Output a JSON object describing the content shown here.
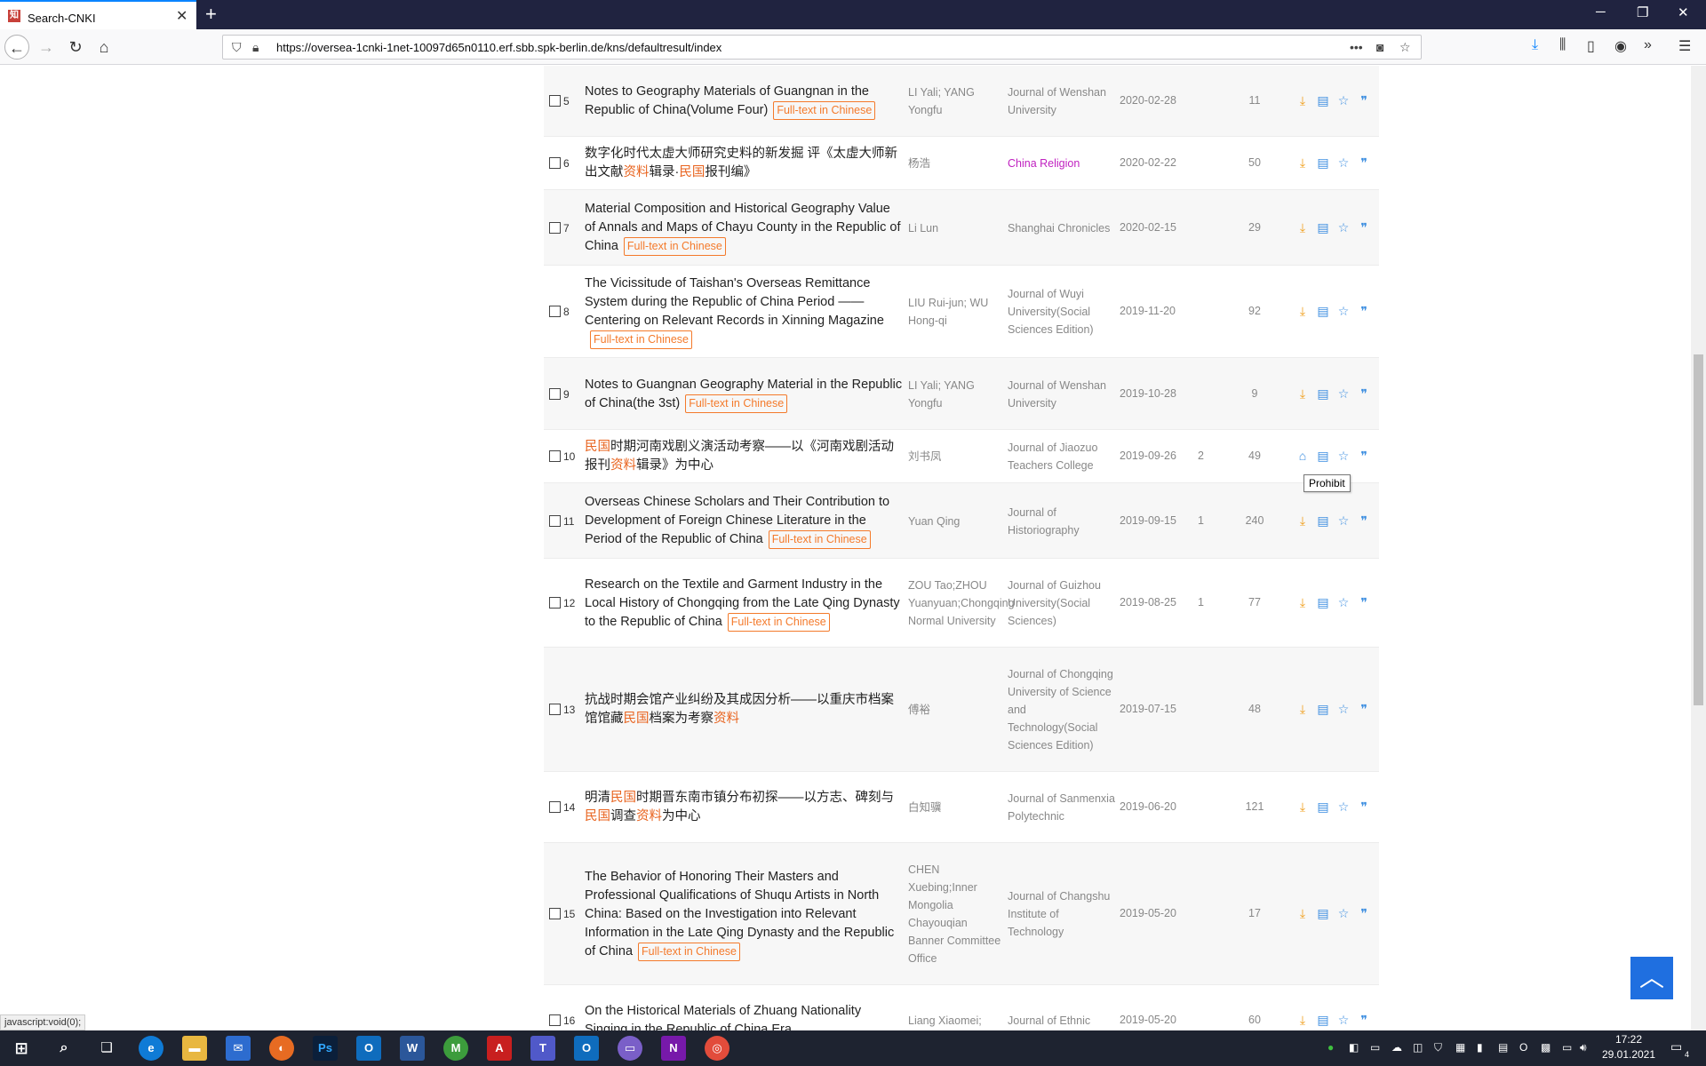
{
  "browser": {
    "tab_title": "Search-CNKI",
    "url": "https://oversea-1cnki-1net-10097d65n0110.erf.sbb.spk-berlin.de/kns/defaultresult/index",
    "status_text": "javascript:void(0);"
  },
  "results": [
    {
      "num": "5",
      "title_parts": [
        {
          "t": "Notes to Geography Materials of Guangnan in the Republic of China(Volume Four)",
          "h": false
        }
      ],
      "badge": "Full-text in Chinese",
      "author": "LI Yali; YANG Yongfu",
      "source": "Journal of Wenshan University",
      "source_link": false,
      "date": "2020-02-28",
      "cited": "",
      "downloads": "11"
    },
    {
      "num": "6",
      "title_parts": [
        {
          "t": "数字化时代太虚大师研究史料的新发掘 评《太虚大师新出文献",
          "h": false
        },
        {
          "t": "资料",
          "h": true
        },
        {
          "t": "辑录·",
          "h": false
        },
        {
          "t": "民国",
          "h": true
        },
        {
          "t": "报刊编》",
          "h": false
        }
      ],
      "badge": "",
      "author": "杨浩",
      "source": "China Religion",
      "source_link": true,
      "date": "2020-02-22",
      "cited": "",
      "downloads": "50"
    },
    {
      "num": "7",
      "title_parts": [
        {
          "t": "Material Composition and Historical Geography Value of Annals and Maps of Chayu County in the Republic of China",
          "h": false
        }
      ],
      "badge": "Full-text in Chinese",
      "author": "Li Lun",
      "source": "Shanghai Chronicles",
      "source_link": false,
      "date": "2020-02-15",
      "cited": "",
      "downloads": "29"
    },
    {
      "num": "8",
      "title_parts": [
        {
          "t": "The Vicissitude of Taishan's Overseas Remittance System during the Republic of China Period ——Centering on Relevant Records in Xinning Magazine",
          "h": false
        }
      ],
      "badge": "Full-text in Chinese",
      "author": "LIU Rui-jun; WU Hong-qi",
      "source": "Journal of Wuyi University(Social Sciences Edition)",
      "source_link": false,
      "date": "2019-11-20",
      "cited": "",
      "downloads": "92"
    },
    {
      "num": "9",
      "title_parts": [
        {
          "t": "Notes to Guangnan Geography Material in the Republic of China(the 3st)",
          "h": false
        }
      ],
      "badge": "Full-text in Chinese",
      "author": "LI Yali; YANG Yongfu",
      "source": "Journal of Wenshan University",
      "source_link": false,
      "date": "2019-10-28",
      "cited": "",
      "downloads": "9"
    },
    {
      "num": "10",
      "title_parts": [
        {
          "t": "民国",
          "h": true
        },
        {
          "t": "时期河南戏剧义演活动考察——以《河南戏剧活动报刊",
          "h": false
        },
        {
          "t": "资料",
          "h": true
        },
        {
          "t": "辑录》为中心",
          "h": false
        }
      ],
      "badge": "",
      "author": "刘书凤",
      "source": "Journal of Jiaozuo Teachers College",
      "source_link": false,
      "date": "2019-09-26",
      "cited": "2",
      "downloads": "49"
    },
    {
      "num": "11",
      "title_parts": [
        {
          "t": "Overseas Chinese Scholars and Their Contribution to Development of Foreign Chinese Literature in the Period of the Republic of China",
          "h": false
        }
      ],
      "badge": "Full-text in Chinese",
      "author": "Yuan Qing",
      "source": "Journal of Historiography",
      "source_link": false,
      "date": "2019-09-15",
      "cited": "1",
      "downloads": "240"
    },
    {
      "num": "12",
      "title_parts": [
        {
          "t": "Research on the Textile and Garment Industry in the Local History of Chongqing from the Late Qing Dynasty to the Republic of China",
          "h": false
        }
      ],
      "badge": "Full-text in Chinese",
      "author": "ZOU Tao;ZHOU Yuanyuan;Chongqing Normal University",
      "source": "Journal of Guizhou University(Social Sciences)",
      "source_link": false,
      "date": "2019-08-25",
      "cited": "1",
      "downloads": "77"
    },
    {
      "num": "13",
      "title_parts": [
        {
          "t": "抗战时期会馆产业纠纷及其成因分析——以重庆市档案馆馆藏",
          "h": false
        },
        {
          "t": "民国",
          "h": true
        },
        {
          "t": "档案为考察",
          "h": false
        },
        {
          "t": "资料",
          "h": true
        }
      ],
      "badge": "",
      "author": "傅裕",
      "source": "Journal of Chongqing University of Science and Technology(Social Sciences Edition)",
      "source_link": false,
      "date": "2019-07-15",
      "cited": "",
      "downloads": "48"
    },
    {
      "num": "14",
      "title_parts": [
        {
          "t": "明清",
          "h": false
        },
        {
          "t": "民国",
          "h": true
        },
        {
          "t": "时期晋东南市镇分布初探——以方志、碑刻与",
          "h": false
        },
        {
          "t": "民国",
          "h": true
        },
        {
          "t": "调查",
          "h": false
        },
        {
          "t": "资料",
          "h": true
        },
        {
          "t": "为中心",
          "h": false
        }
      ],
      "badge": "",
      "author": "白知骥",
      "source": "Journal of Sanmenxia Polytechnic",
      "source_link": false,
      "date": "2019-06-20",
      "cited": "",
      "downloads": "121"
    },
    {
      "num": "15",
      "title_parts": [
        {
          "t": "The Behavior of Honoring Their Masters and Professional Qualifications of Shuqu Artists in North China: Based on the Investigation into Relevant Information in the Late Qing Dynasty and the Republic of China",
          "h": false
        }
      ],
      "badge": "Full-text in Chinese",
      "author": "CHEN Xuebing;Inner Mongolia Chayouqian Banner Committee Office",
      "source": "Journal of Changshu Institute of Technology",
      "source_link": false,
      "date": "2019-05-20",
      "cited": "",
      "downloads": "17"
    },
    {
      "num": "16",
      "title_parts": [
        {
          "t": "On the Historical Materials of Zhuang Nationality Singing in the Republic of China Era",
          "h": false
        }
      ],
      "badge": "",
      "author": "Liang Xiaomei;",
      "source": "Journal of Ethnic",
      "source_link": false,
      "date": "2019-05-20",
      "cited": "",
      "downloads": "60"
    }
  ],
  "tooltip": "Prohibit",
  "taskbar": {
    "time": "17:22",
    "date": "29.01.2021",
    "notification_count": "4"
  },
  "colors": {
    "highlight": "#e8631e",
    "badge": "#f47a2b",
    "source_link": "#c021c0",
    "action_blue": "#3b8de0",
    "download_orange": "#f0a020",
    "back_to_top": "#1f6fe0"
  }
}
